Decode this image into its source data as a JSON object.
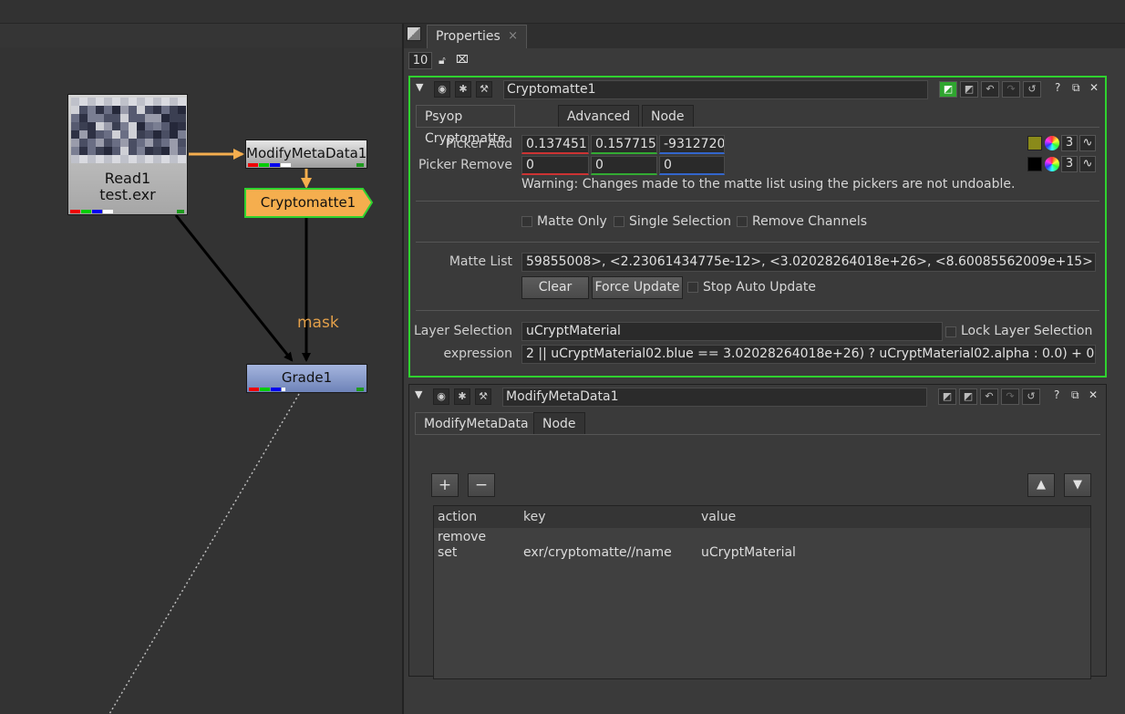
{
  "node_graph": {
    "read_node": {
      "name": "Read1",
      "file": "test.exr"
    },
    "modify_node": {
      "name": "ModifyMetaData1"
    },
    "crypto_node": {
      "name": "Cryptomatte1"
    },
    "grade_node": {
      "name": "Grade1"
    },
    "mask_label": "mask"
  },
  "properties": {
    "tab_label": "Properties",
    "tab_close": "×",
    "panel_count": "10"
  },
  "cryptomatte_panel": {
    "name": "Cryptomatte1",
    "tabs": [
      "Psyop Cryptomatte",
      "Advanced",
      "Node"
    ],
    "picker_add_label": "Picker Add",
    "picker_add_values": [
      "0.137451",
      "0.157715",
      "-9312720"
    ],
    "picker_remove_label": "Picker Remove",
    "picker_remove_values": [
      "0",
      "0",
      "0"
    ],
    "picker_count": "3",
    "warning": "Warning: Changes made to the matte list using the pickers are not undoable.",
    "matte_only": "Matte Only",
    "single_selection": "Single Selection",
    "remove_channels": "Remove Channels",
    "matte_list_label": "Matte List",
    "matte_list_value": "59855008>, <2.23061434775e-12>, <3.02028264018e+26>, <8.60085562009e+15>",
    "clear_button": "Clear",
    "force_update_button": "Force Update",
    "stop_auto_update": "Stop Auto Update",
    "layer_selection_label": "Layer Selection",
    "layer_selection_value": "uCryptMaterial",
    "lock_layer_selection": "Lock Layer Selection",
    "expression_label": "expression",
    "expression_value": "2 || uCryptMaterial02.blue == 3.02028264018e+26) ? uCryptMaterial02.alpha : 0.0) + 0"
  },
  "modify_panel": {
    "name": "ModifyMetaData1",
    "tabs": [
      "ModifyMetaData",
      "Node"
    ],
    "add_button": "+",
    "remove_button": "−",
    "up_button": "▲",
    "down_button": "▼",
    "columns": [
      "action",
      "key",
      "value"
    ],
    "rows": [
      {
        "action": "remove",
        "key": "",
        "value": ""
      },
      {
        "action": "set",
        "key": "exr/cryptomatte//name",
        "value": "uCryptMaterial"
      }
    ]
  },
  "colors": {
    "selected_border": "#2fd22f",
    "crypto_node_fill": "#f5ae4e",
    "arrow_orange": "#f5ae4e",
    "picker_add_swatch": "#8a8a1a",
    "picker_remove_swatch": "#000000"
  },
  "icons": [
    "lock-icon",
    "pin-icon",
    "collapse-icon",
    "eye-icon",
    "camera-icon",
    "wrench-icon",
    "undo-icon",
    "redo-icon",
    "revert-icon",
    "help-icon",
    "float-icon",
    "close-icon"
  ]
}
